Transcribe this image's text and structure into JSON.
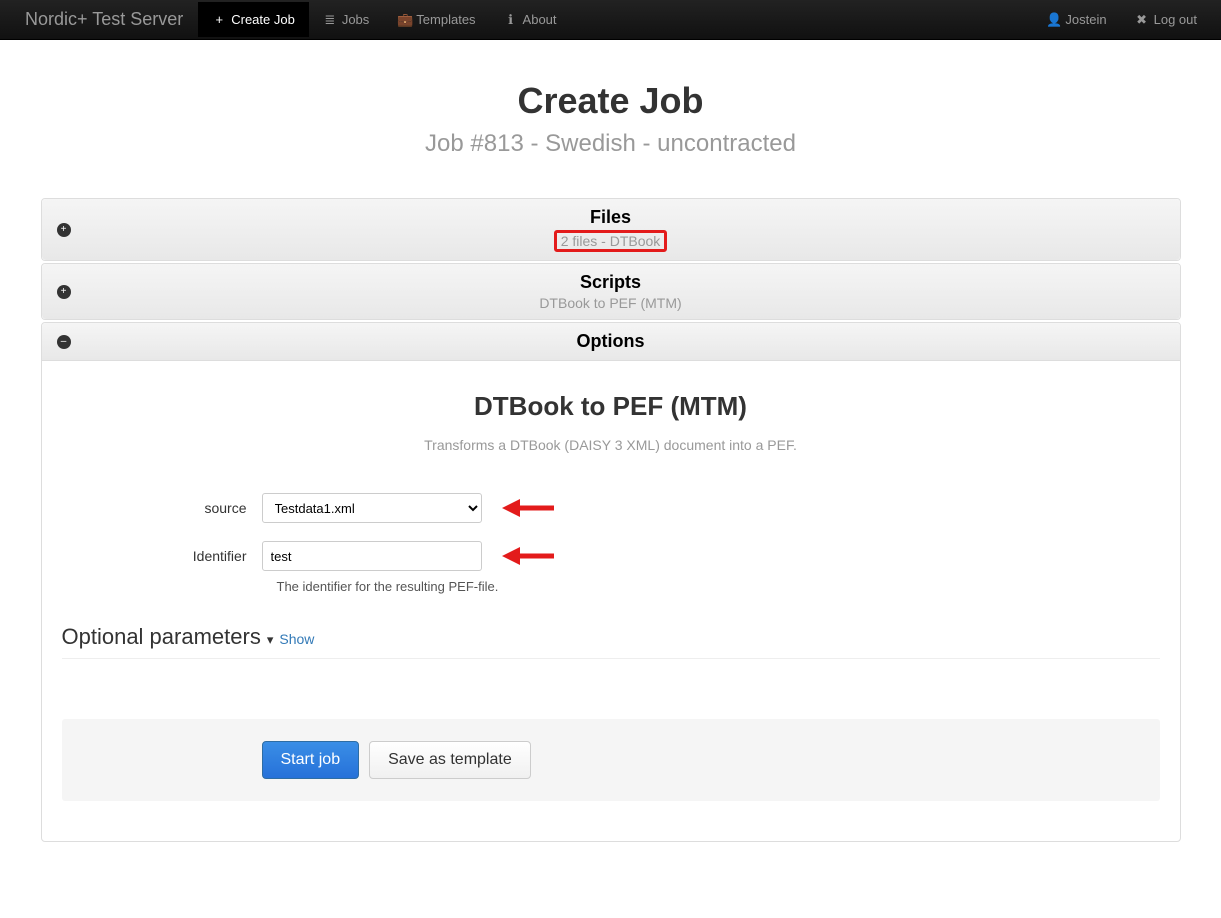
{
  "navbar": {
    "brand": "Nordic+ Test Server",
    "items": [
      {
        "icon": "+",
        "label": "Create Job",
        "active": true
      },
      {
        "icon": "≣",
        "label": "Jobs",
        "active": false
      },
      {
        "icon": "💼",
        "label": "Templates",
        "active": false
      },
      {
        "icon": "ℹ",
        "label": "About",
        "active": false
      }
    ],
    "user": "Jostein",
    "logout": "Log out"
  },
  "header": {
    "title": "Create Job",
    "subtitle": "Job #813 - Swedish - uncontracted"
  },
  "panels": {
    "files": {
      "title": "Files",
      "subtitle": "2 files - DTBook"
    },
    "scripts": {
      "title": "Scripts",
      "subtitle": "DTBook to PEF (MTM)"
    },
    "options": {
      "title": "Options"
    }
  },
  "form": {
    "section_title": "DTBook to PEF (MTM)",
    "section_desc": "Transforms a DTBook (DAISY 3 XML) document into a PEF.",
    "source_label": "source",
    "source_value": "Testdata1.xml",
    "identifier_label": "Identifier",
    "identifier_value": "test",
    "identifier_help": "The identifier for the resulting PEF-file.",
    "optional_title": "Optional parameters",
    "show_label": "Show"
  },
  "actions": {
    "start": "Start job",
    "save_template": "Save as template"
  }
}
